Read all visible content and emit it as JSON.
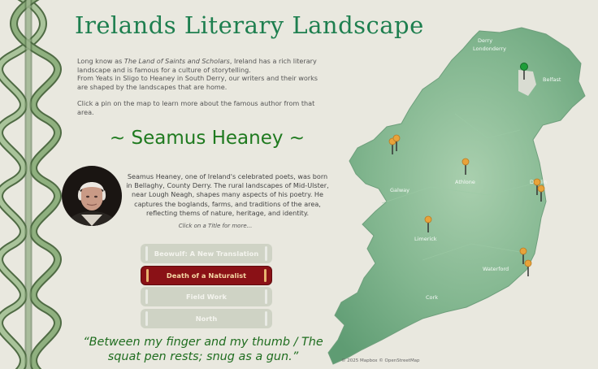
{
  "header": {
    "title": "Irelands Literary Landscape"
  },
  "intro": {
    "p1_before": "Long know as ",
    "p1_em": "The Land of Saints and Scholars",
    "p1_after": ", Ireland has a rich literary landscape and is famous for a culture of storytelling.",
    "p2": "From Yeats in Sligo to Heaney in South Derry, our writers and their works are shaped by the landscapes that are home.",
    "p3": "Click a pin on the map to learn more about the famous author from that area."
  },
  "author": {
    "name": "~ Seamus Heaney ~",
    "bio": "Seamus Heaney, one of Ireland's celebrated poets, was born in Bellaghy, County Derry. The rural landscapes of Mid-Ulster, near Lough Neagh, shapes many aspects of his poetry. He captures the boglands, farms, and traditions of the area, reflecting thems of nature, heritage, and identity.",
    "hint": "Click on a Title for more...",
    "books": [
      {
        "label": "Beowulf: A New Translation",
        "state": "faded"
      },
      {
        "label": "Death of a Naturalist",
        "state": "active"
      },
      {
        "label": "Field Work",
        "state": "faded"
      },
      {
        "label": "North",
        "state": "faded"
      }
    ],
    "quote": "“Between my finger and my thumb / The squat pen rests; snug as a gun.”"
  },
  "map": {
    "labels": {
      "derry": "Derry",
      "londonderry": "Londonderry",
      "belfast": "Belfast",
      "galway": "Galway",
      "limerick": "Limerick",
      "waterford": "Waterford",
      "cork": "Cork",
      "dublin": "Dublin",
      "athlone": "Athlone"
    },
    "attribution": "© 2025 Mapbox © OpenStreetMap",
    "pin_colors": {
      "default": "#e8a33a",
      "selected": "#1e9e3a"
    }
  }
}
